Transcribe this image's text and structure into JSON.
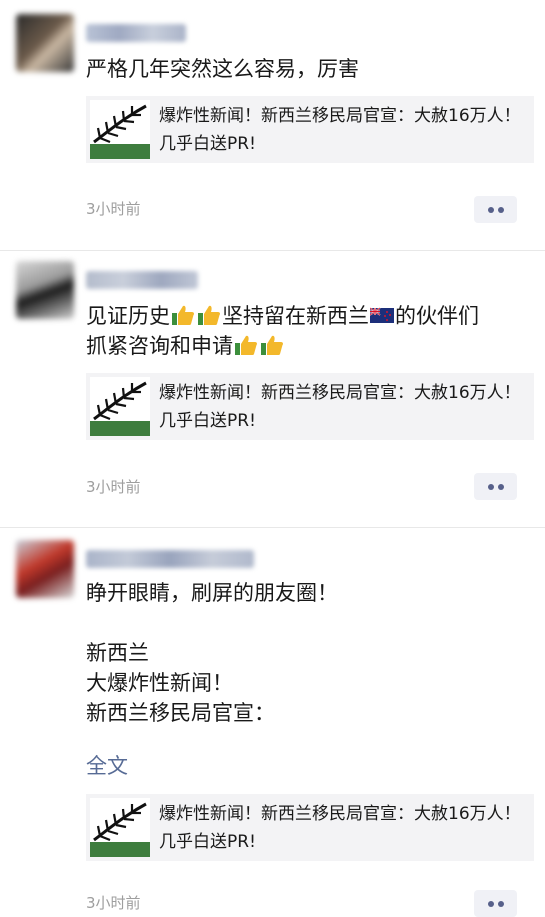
{
  "posts": [
    {
      "content_lines": [
        "严格几年突然这么容易，厉害"
      ],
      "link_title": "爆炸性新闻！新西兰移民局官宣：大赦16万人！几乎白送PR!",
      "time": "3小时前"
    },
    {
      "content_lines": [
        "见证历史",
        "坚持留在新西兰",
        "的伙伴们",
        "抓紧咨询和申请"
      ],
      "link_title": "爆炸性新闻！新西兰移民局官宣：大赦16万人！几乎白送PR!",
      "time": "3小时前"
    },
    {
      "content_lines": [
        "睁开眼睛，刷屏的朋友圈！",
        "新西兰",
        "大爆炸性新闻！",
        "新西兰移民局官宣："
      ],
      "full_text_label": "全文",
      "link_title": "爆炸性新闻！新西兰移民局官宣：大赦16万人！几乎白送PR!",
      "time": "3小时前"
    }
  ],
  "icons": {
    "thumb": "thumbs-up-icon",
    "flag": "new-zealand-flag-icon",
    "fern": "silver-fern-icon"
  },
  "colors": {
    "link": "#576b95",
    "time": "#9e9e9e",
    "card_bg": "#f3f3f5"
  }
}
